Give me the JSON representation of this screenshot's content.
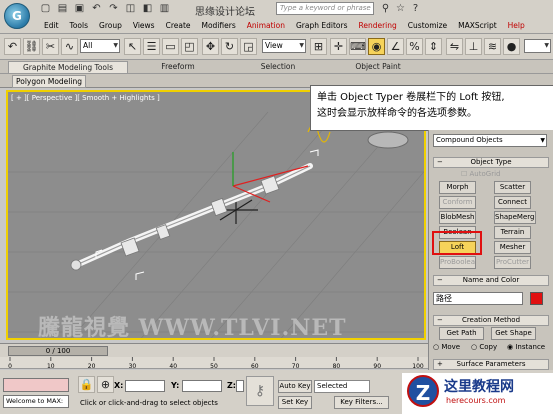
{
  "titlebar": {
    "title": "思缘设计论坛",
    "search_placeholder": "Type a keyword or phrase",
    "site_url": "www.MISSYUAN.COM"
  },
  "menus": [
    "Edit",
    "Tools",
    "Group",
    "Views",
    "Create",
    "Modifiers",
    "Animation",
    "Graph Editors",
    "Rendering",
    "Customize",
    "MAXScript",
    "Help"
  ],
  "toolbar": {
    "selection_filter": "All",
    "reference_coord": "View"
  },
  "ribbon": {
    "tabs": [
      "Graphite Modeling Tools",
      "Freeform",
      "Selection",
      "Object Paint"
    ],
    "subtab": "Polygon Modeling"
  },
  "viewport": {
    "label": "[ + ][ Perspective ][ Smooth + Highlights ]",
    "watermark": "騰龍視覺 WWW.TLVI.NET"
  },
  "callout": {
    "line1": "单击 Object Typer 卷展栏下的 Loft 按钮,",
    "line2": "这时会显示放样命令的各选项参数。"
  },
  "command_panel": {
    "category": "Compound Objects",
    "object_type_title": "Object Type",
    "autogrid": "AutoGrid",
    "buttons": [
      "Morph",
      "Scatter",
      "Conform",
      "Connect",
      "BlobMesh",
      "ShapeMerge",
      "Boolean",
      "Terrain",
      "Loft",
      "Mesher",
      "ProBoolean",
      "ProCutter"
    ],
    "name_color_title": "Name and Color",
    "object_name": "路径",
    "object_color": "#e01010",
    "creation_method_title": "Creation Method",
    "get_path": "Get Path",
    "get_shape": "Get Shape",
    "radio_move": "Move",
    "radio_copy": "Copy",
    "radio_instance": "Instance",
    "surface_params_title": "Surface Parameters"
  },
  "timeline": {
    "frame": "0 / 100"
  },
  "ruler_ticks": [
    "0",
    "10",
    "20",
    "30",
    "40",
    "50",
    "60",
    "70",
    "80",
    "90",
    "100"
  ],
  "status": {
    "welcome": "Welcome to MAX:",
    "prompt": "Click or click-and-drag to select objects",
    "x_label": "X:",
    "y_label": "Y:",
    "z_label": "Z:",
    "auto_key": "Auto Key",
    "set_key": "Set Key",
    "key_selected": "Selected",
    "key_filters": "Key Filters..."
  },
  "site_logo": {
    "title": "这里教程网",
    "url": "herecours.com"
  }
}
